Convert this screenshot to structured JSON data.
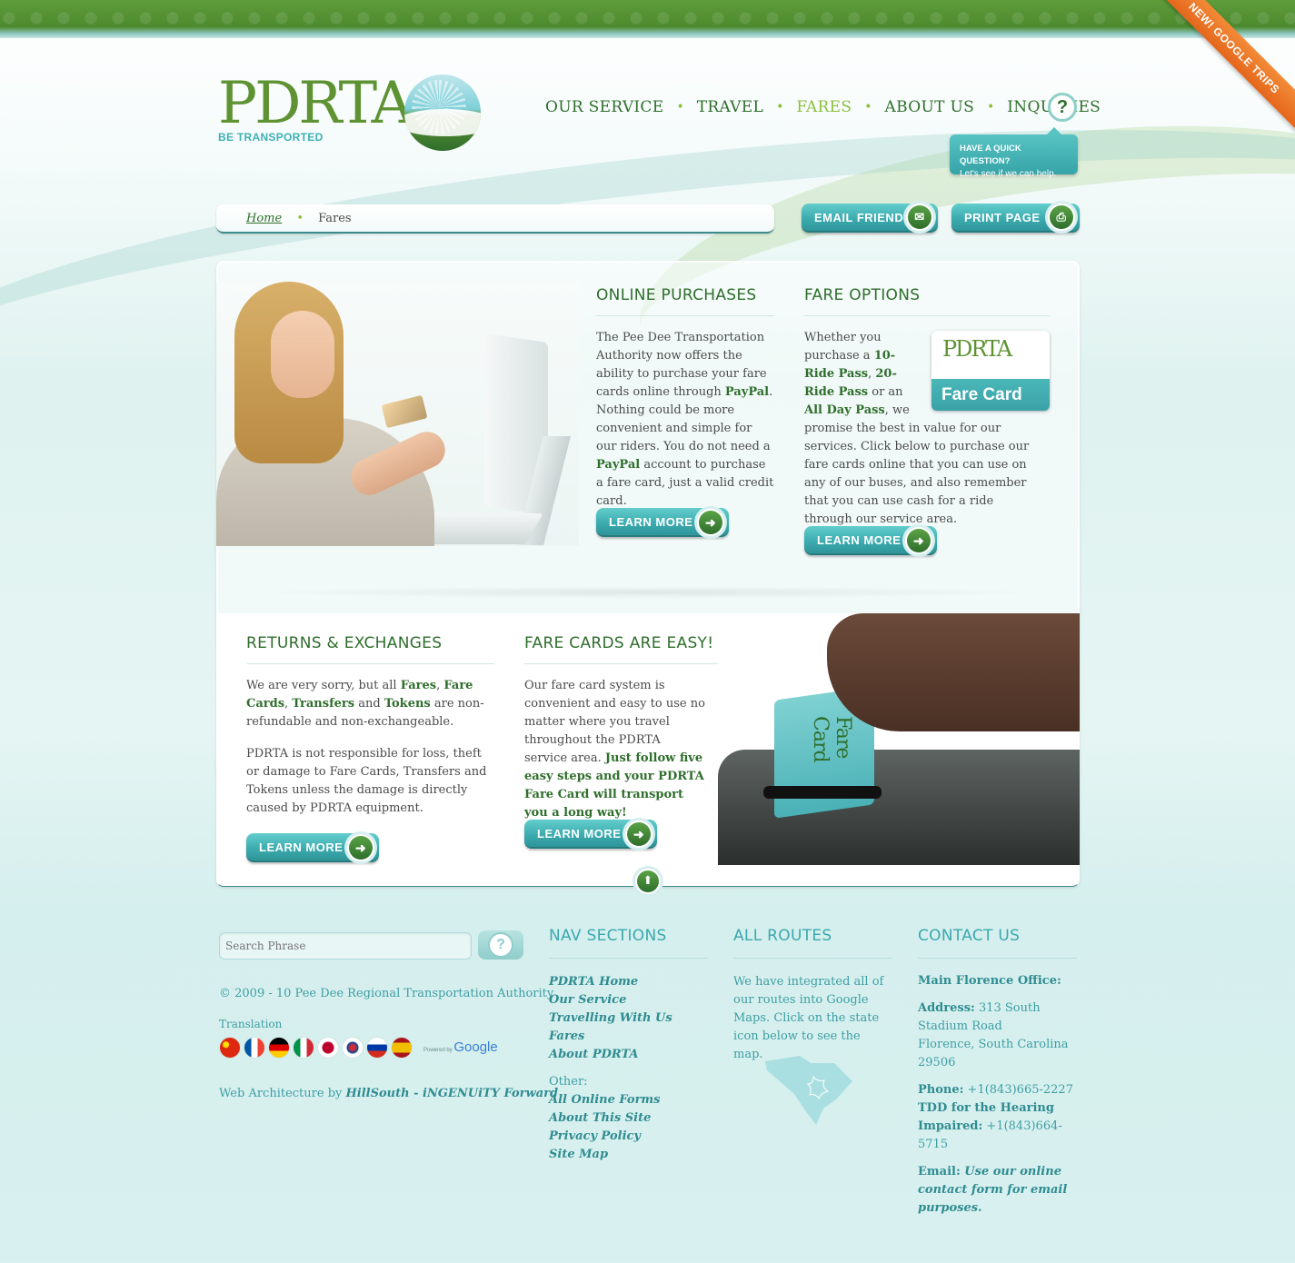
{
  "ribbon": "NEW! GOOGLE TRIPS",
  "logo": {
    "text": "PDRTA",
    "tagline": "BE TRANSPORTED"
  },
  "nav": {
    "items": [
      {
        "label": "OUR SERVICE",
        "active": false
      },
      {
        "label": "TRAVEL",
        "active": false
      },
      {
        "label": "FARES",
        "active": true
      },
      {
        "label": "ABOUT US",
        "active": false
      },
      {
        "label": "INQUIRIES",
        "active": false
      }
    ],
    "help_icon": "question-icon",
    "help_label": "?",
    "quick_question": {
      "line1": "HAVE A QUICK QUESTION?",
      "line2": "Let's see if we can help."
    }
  },
  "breadcrumb": {
    "home": "Home",
    "current": "Fares"
  },
  "toolbar": {
    "email_label": "EMAIL FRIEND",
    "print_label": "PRINT PAGE"
  },
  "online_purchases": {
    "title": "ONLINE PURCHASES",
    "text": [
      {
        "t": "The Pee Dee Transportation Authority now offers the ability to purchase your fare cards online through "
      },
      {
        "b": "PayPal"
      },
      {
        "t": ". Nothing could be more convenient and simple for our riders. You do not need a "
      },
      {
        "b": "PayPal"
      },
      {
        "t": " account to purchase a fare card, just a valid credit card."
      }
    ],
    "button": "LEARN MORE"
  },
  "fare_options": {
    "title": "FARE OPTIONS",
    "text": [
      {
        "t": "Whether you purchase a "
      },
      {
        "b": "10-Ride Pass"
      },
      {
        "t": ", "
      },
      {
        "b": "20-Ride Pass"
      },
      {
        "t": " or an "
      },
      {
        "b": "All Day Pass"
      },
      {
        "t": ", we promise the best in value for our services. Click below to purchase our fare cards online that you can use on any of our buses, and also remember that you can use cash for a ride through our service area."
      }
    ],
    "card_logo": "PDRTA",
    "card_label": "Fare Card",
    "button": "LEARN MORE"
  },
  "returns": {
    "title": "RETURNS & EXCHANGES",
    "p1": [
      {
        "t": "We are very sorry, but all "
      },
      {
        "b": "Fares"
      },
      {
        "t": ", "
      },
      {
        "b": "Fare Cards"
      },
      {
        "t": ", "
      },
      {
        "b": "Transfers"
      },
      {
        "t": " and "
      },
      {
        "b": "Tokens"
      },
      {
        "t": " are non-refundable and non-exchangeable."
      }
    ],
    "p2": "PDRTA is not responsible for loss, theft or damage to Fare Cards, Transfers and Tokens unless the damage is directly caused by PDRTA equipment.",
    "button": "LEARN MORE"
  },
  "fare_cards_easy": {
    "title": "FARE CARDS ARE EASY!",
    "text": [
      {
        "t": "Our fare card system is convenient and easy to use no matter where you travel throughout the PDRTA service area. "
      },
      {
        "b": "Just follow five easy steps and your PDRTA Fare Card will transport you a long way!"
      }
    ],
    "button": "LEARN MORE",
    "photo_card_text": "Fare Card"
  },
  "footer": {
    "search_placeholder": "Search Phrase",
    "copyright": "© 2009 - 10 Pee Dee Regional Transportation Authority",
    "translation_label": "Translation",
    "flags": [
      {
        "name": "china-flag",
        "colors": [
          "#de2910",
          "#ffde00"
        ]
      },
      {
        "name": "france-flag",
        "colors": [
          "#0055a4",
          "#ffffff",
          "#ef4135"
        ]
      },
      {
        "name": "germany-flag",
        "colors": [
          "#000000",
          "#dd0000",
          "#ffce00"
        ]
      },
      {
        "name": "italy-flag",
        "colors": [
          "#009246",
          "#ffffff",
          "#ce2b37"
        ]
      },
      {
        "name": "japan-flag",
        "colors": [
          "#ffffff",
          "#bc002d"
        ]
      },
      {
        "name": "korea-flag",
        "colors": [
          "#ffffff",
          "#cd2e3a",
          "#0047a0"
        ]
      },
      {
        "name": "russia-flag",
        "colors": [
          "#ffffff",
          "#0039a6",
          "#d52b1e"
        ]
      },
      {
        "name": "spain-flag",
        "colors": [
          "#aa151b",
          "#f1bf00",
          "#aa151b"
        ]
      }
    ],
    "powered_by": "Powered by",
    "google": "Google",
    "web_arch_prefix": "Web Architecture by ",
    "web_arch_name": "HillSouth - iNGENUiTY Forward",
    "nav_sections": {
      "title": "NAV SECTIONS",
      "links": [
        "PDRTA Home",
        "Our Service",
        "Travelling With Us",
        "Fares",
        "About PDRTA"
      ],
      "other_label": "Other:",
      "other_links": [
        "All Online Forms",
        "About This Site",
        "Privacy Policy",
        "Site Map"
      ]
    },
    "all_routes": {
      "title": "ALL ROUTES",
      "text": "We have integrated all of our routes into Google Maps. Click on the state icon below to see the map."
    },
    "contact": {
      "title": "CONTACT US",
      "office": "Main Florence Office:",
      "address_label": "Address:",
      "address": " 313 South Stadium Road",
      "city": "Florence, South Carolina",
      "zip": " 29506",
      "phone_label": "Phone:",
      "phone": " +1(843)665-2227",
      "tdd_label": "TDD for the Hearing Impaired:",
      "tdd": " +1(843)664-5715",
      "email_label": "Email:",
      "email_text": " Use our online contact form for email purposes."
    }
  }
}
